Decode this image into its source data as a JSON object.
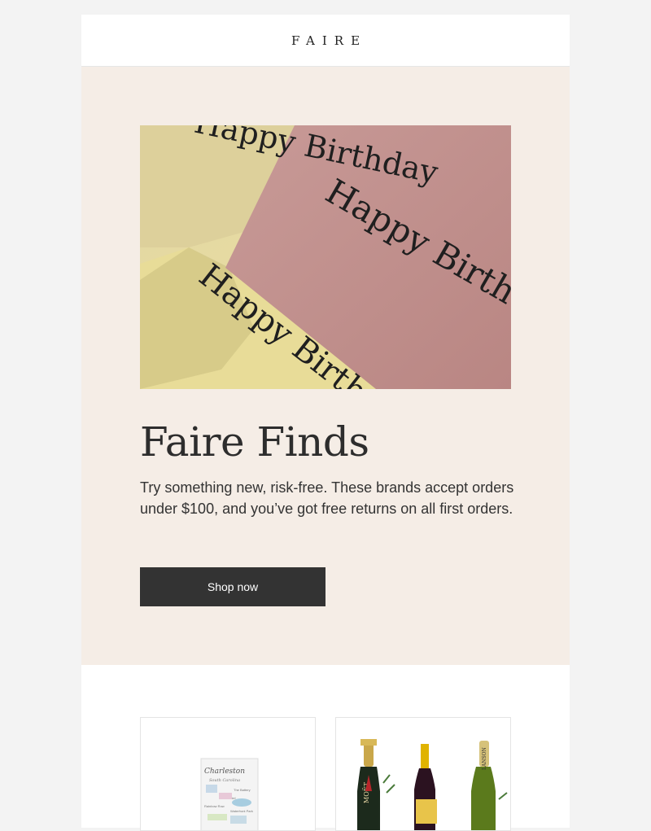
{
  "header": {
    "logo": "FAIRE"
  },
  "hero": {
    "image_alt": "Greeting cards",
    "image_text": [
      "Happy Birthday",
      "Happy Birthday",
      "Happy Birthday"
    ],
    "title": "Faire Finds",
    "body": "Try something new, risk-free. These brands accept orders under $100, and you’ve got free returns on all first orders.",
    "cta_label": "Shop now"
  },
  "products": {
    "items": [
      {
        "image_text": [
          "Charleston",
          "South Carolina",
          "The Battery",
          "The Citadel",
          "Rainbow Row",
          "Waterfront Park"
        ]
      },
      {
        "image_text": [
          "MOËT",
          "LANSON"
        ]
      }
    ]
  },
  "colors": {
    "hero_bg": "#f5ede6",
    "button_bg": "#333333",
    "card_pink": "#c08e8b",
    "card_yellow": "#e9dea3"
  }
}
